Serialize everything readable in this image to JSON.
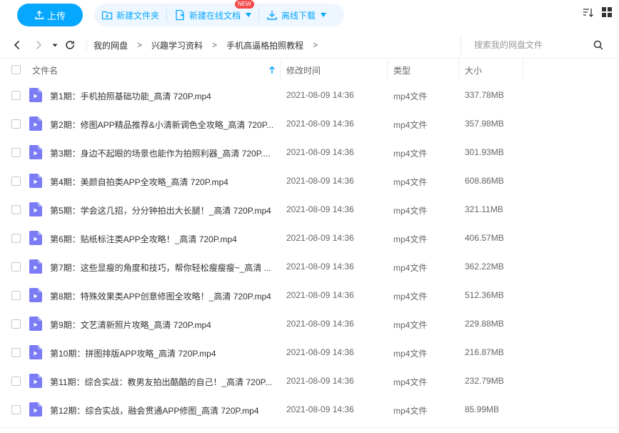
{
  "toolbar": {
    "upload_label": "上传",
    "new_folder_label": "新建文件夹",
    "new_doc_label": "新建在线文档",
    "new_badge": "NEW",
    "offline_download_label": "离线下载"
  },
  "nav": {
    "breadcrumbs": [
      "我的网盘",
      "兴趣学习资料",
      "手机高逼格拍照教程"
    ],
    "search_placeholder": "搜索我的网盘文件"
  },
  "table": {
    "headers": {
      "name": "文件名",
      "modified": "修改时间",
      "type": "类型",
      "size": "大小"
    },
    "files": [
      {
        "name": "第1期：手机拍照基础功能_高清 720P.mp4",
        "modified": "2021-08-09 14:36",
        "type": "mp4文件",
        "size": "337.78MB"
      },
      {
        "name": "第2期：修图APP精品推荐&小清新调色全攻略_高清 720P...",
        "modified": "2021-08-09 14:36",
        "type": "mp4文件",
        "size": "357.98MB"
      },
      {
        "name": "第3期：身边不起眼的场景也能作为拍照利器_高清 720P....",
        "modified": "2021-08-09 14:36",
        "type": "mp4文件",
        "size": "301.93MB"
      },
      {
        "name": "第4期：美颜自拍类APP全攻略_高清 720P.mp4",
        "modified": "2021-08-09 14:36",
        "type": "mp4文件",
        "size": "608.86MB"
      },
      {
        "name": "第5期：学会这几招，分分钟拍出大长腿！_高清 720P.mp4",
        "modified": "2021-08-09 14:36",
        "type": "mp4文件",
        "size": "321.11MB"
      },
      {
        "name": "第6期：贴纸标注类APP全攻略！_高清 720P.mp4",
        "modified": "2021-08-09 14:36",
        "type": "mp4文件",
        "size": "406.57MB"
      },
      {
        "name": "第7期：这些显瘦的角度和技巧，帮你轻松瘦瘦瘦~_高清 ...",
        "modified": "2021-08-09 14:36",
        "type": "mp4文件",
        "size": "362.22MB"
      },
      {
        "name": "第8期：特殊效果类APP创意修图全攻略！_高清 720P.mp4",
        "modified": "2021-08-09 14:36",
        "type": "mp4文件",
        "size": "512.36MB"
      },
      {
        "name": "第9期：文艺清新照片攻略_高清 720P.mp4",
        "modified": "2021-08-09 14:36",
        "type": "mp4文件",
        "size": "229.88MB"
      },
      {
        "name": "第10期：拼图排版APP攻略_高清 720P.mp4",
        "modified": "2021-08-09 14:36",
        "type": "mp4文件",
        "size": "216.87MB"
      },
      {
        "name": "第11期：综合实战：教男友拍出酷酷的自己！_高清 720P...",
        "modified": "2021-08-09 14:36",
        "type": "mp4文件",
        "size": "232.79MB"
      },
      {
        "name": "第12期：综合实战，融会贯通APP修图_高清 720P.mp4",
        "modified": "2021-08-09 14:36",
        "type": "mp4文件",
        "size": "85.99MB"
      }
    ]
  },
  "colors": {
    "accent": "#06a7ff",
    "file_icon": "#7b7cf5",
    "badge": "#f44a4a"
  }
}
